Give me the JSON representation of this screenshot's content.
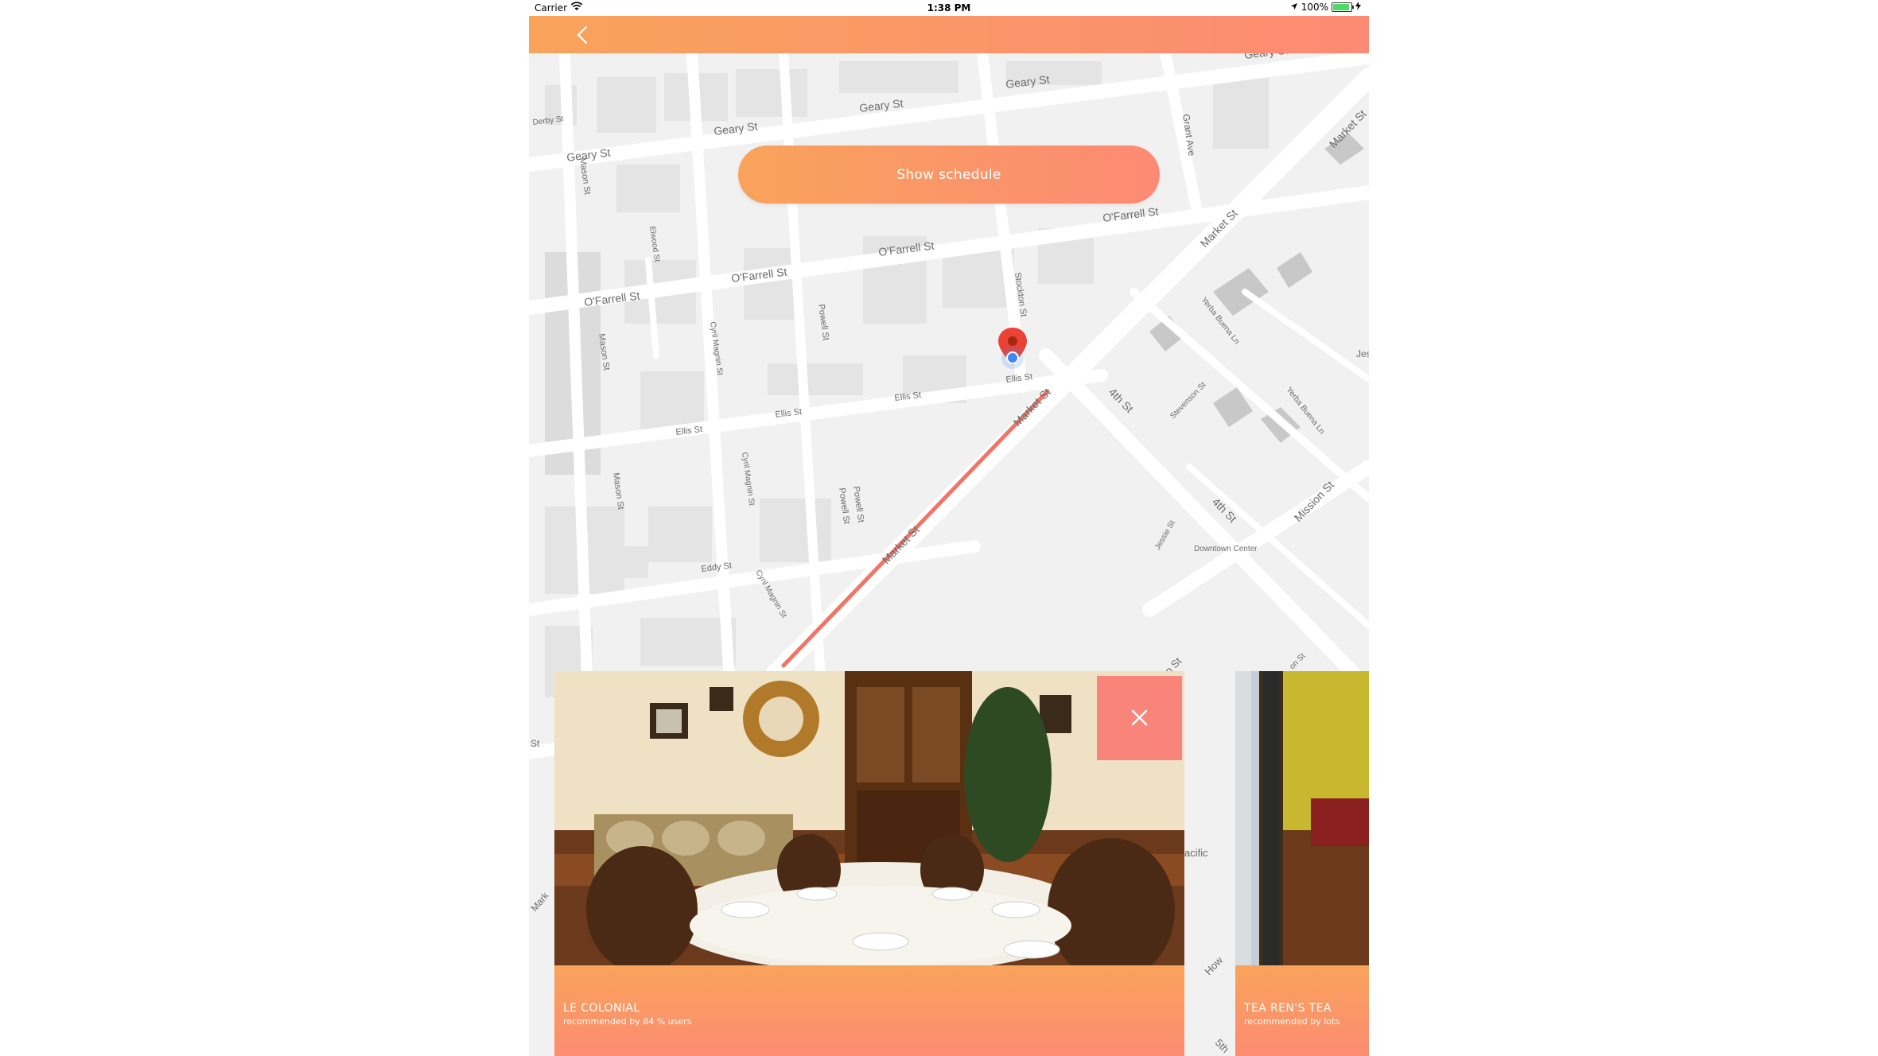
{
  "status_bar": {
    "carrier": "Carrier",
    "time": "1:38 PM",
    "battery": "100%"
  },
  "nav": {
    "back_icon": "chevron-left-icon"
  },
  "map": {
    "streets": [
      "Geary St",
      "Geary St",
      "Geary St",
      "Geary St",
      "Geary St",
      "O'Farrell St",
      "O'Farrell St",
      "O'Farrell St",
      "O'Farrell St",
      "Ellis St",
      "Ellis St",
      "Ellis St",
      "Ellis St",
      "Eddy St",
      "Market St",
      "Market St",
      "Market St",
      "Market St",
      "Mission St",
      "4th St",
      "4th St",
      "Grant Ave",
      "Stockton St",
      "Powell St",
      "Powell St",
      "Powell St",
      "Mason St",
      "Mason St",
      "Mason St",
      "Cyril Magnin St",
      "Cyril Magnin St",
      "Cyril Magnin St",
      "Elwood St",
      "Derby St",
      "Yerba Buena Ln",
      "Yerba Buena Ln",
      "Stevenson St",
      "Jessie St",
      "Downtown Center",
      "Jes",
      "acific",
      "How",
      "5th",
      "on St",
      "St",
      "Mark",
      "on St"
    ],
    "marker_color": "#ea4335",
    "location_color": "#4285f4",
    "route_color": "#f07467"
  },
  "schedule_button": {
    "label": "Show schedule"
  },
  "cards": [
    {
      "name": "LE COLONIAL",
      "reco": "recommended by 84 % users"
    },
    {
      "name": "TEA REN'S TEA",
      "reco": "recommended by lots"
    }
  ],
  "close_icon": "close-icon",
  "colors": {
    "accent_start": "#f9a35b",
    "accent_end": "#fc8a74"
  }
}
